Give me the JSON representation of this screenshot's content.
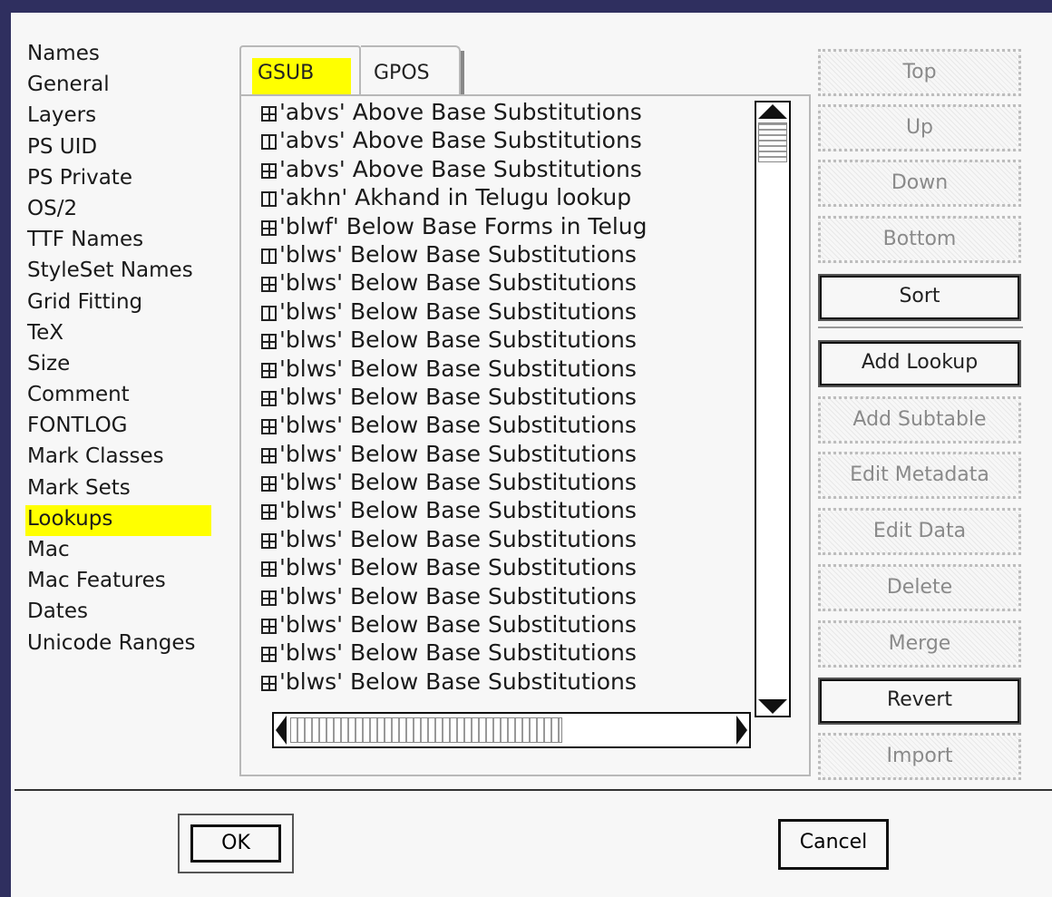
{
  "sidebar": {
    "items": [
      "Names",
      "General",
      "Layers",
      "PS UID",
      "PS Private",
      "OS/2",
      "TTF Names",
      "StyleSet Names",
      "Grid Fitting",
      "TeX",
      "Size",
      "Comment",
      "FONTLOG",
      "Mark Classes",
      "Mark Sets",
      "Lookups",
      "Mac",
      "Mac Features",
      "Dates",
      "Unicode Ranges"
    ],
    "selected": "Lookups"
  },
  "tabs": {
    "gsub": "GSUB",
    "gpos": "GPOS",
    "active": "GSUB"
  },
  "lookups": [
    {
      "text": "'abvs' Above Base Substitutions",
      "state": "expanded"
    },
    {
      "text": "'abvs' Above Base Substitutions",
      "state": "collapsed"
    },
    {
      "text": "'abvs' Above Base Substitutions",
      "state": "expanded"
    },
    {
      "text": "'akhn' Akhand in Telugu lookup",
      "state": "collapsed"
    },
    {
      "text": "'blwf' Below Base Forms in Telug",
      "state": "expanded"
    },
    {
      "text": "'blws' Below Base Substitutions",
      "state": "collapsed"
    },
    {
      "text": "'blws' Below Base Substitutions",
      "state": "expanded"
    },
    {
      "text": "'blws' Below Base Substitutions",
      "state": "collapsed"
    },
    {
      "text": "'blws' Below Base Substitutions",
      "state": "expanded"
    },
    {
      "text": "'blws' Below Base Substitutions",
      "state": "expanded"
    },
    {
      "text": "'blws' Below Base Substitutions",
      "state": "expanded"
    },
    {
      "text": "'blws' Below Base Substitutions",
      "state": "expanded"
    },
    {
      "text": "'blws' Below Base Substitutions",
      "state": "expanded"
    },
    {
      "text": "'blws' Below Base Substitutions",
      "state": "expanded"
    },
    {
      "text": "'blws' Below Base Substitutions",
      "state": "expanded"
    },
    {
      "text": "'blws' Below Base Substitutions",
      "state": "expanded"
    },
    {
      "text": "'blws' Below Base Substitutions",
      "state": "expanded"
    },
    {
      "text": "'blws' Below Base Substitutions",
      "state": "expanded"
    },
    {
      "text": "'blws' Below Base Substitutions",
      "state": "expanded"
    },
    {
      "text": "'blws' Below Base Substitutions",
      "state": "expanded"
    },
    {
      "text": "'blws' Below Base Substitutions",
      "state": "expanded"
    }
  ],
  "buttons": {
    "top": "Top",
    "up": "Up",
    "down": "Down",
    "bottom": "Bottom",
    "sort": "Sort",
    "add_lookup": "Add Lookup",
    "add_subtable": "Add Subtable",
    "edit_metadata": "Edit Metadata",
    "edit_data": "Edit Data",
    "delete": "Delete",
    "merge": "Merge",
    "revert": "Revert",
    "import": "Import"
  },
  "dialog": {
    "ok": "OK",
    "cancel": "Cancel"
  },
  "colors": {
    "highlight": "#ffff00",
    "frame": "#2f2f5f"
  }
}
